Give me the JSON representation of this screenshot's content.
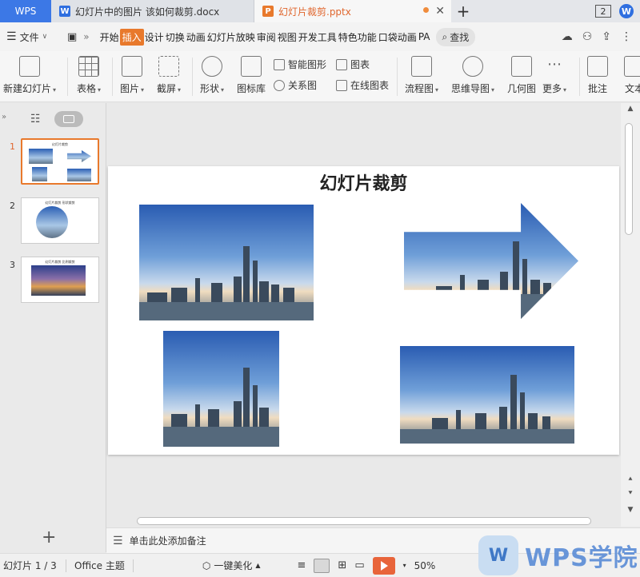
{
  "titlebar": {
    "app_tab": "WPS",
    "tabs": [
      {
        "label": "幻灯片中的图片 该如何裁剪.docx",
        "icon": "W"
      },
      {
        "label": "幻灯片裁剪.pptx",
        "icon": "P"
      }
    ],
    "badge_num": "2"
  },
  "menubar": {
    "file": "文件",
    "items": [
      "开始",
      "插入",
      "设计",
      "切换",
      "动画",
      "幻灯片放映",
      "审阅",
      "视图",
      "开发工具",
      "特色功能",
      "口袋动画",
      "PA"
    ],
    "active": "插入",
    "search": "查找"
  },
  "ribbon": {
    "new_slide": "新建幻灯片",
    "table": "表格",
    "picture": "图片",
    "screenshot": "截屏",
    "shape": "形状",
    "icon_lib": "图标库",
    "smart_art": "智能图形",
    "chart": "图表",
    "relation": "关系图",
    "online_chart": "在线图表",
    "flowchart": "流程图",
    "mindmap": "思维导图",
    "geometry": "几何图",
    "more": "更多",
    "comment": "批注",
    "text": "文本"
  },
  "thumbnails": [
    {
      "num": "1",
      "title": "幻灯片裁剪"
    },
    {
      "num": "2",
      "title": "幻灯片裁剪 形状裁剪"
    },
    {
      "num": "3",
      "title": "幻灯片裁剪 比例裁剪"
    }
  ],
  "slide": {
    "title": "幻灯片裁剪"
  },
  "notes": {
    "placeholder": "单击此处添加备注"
  },
  "statusbar": {
    "slide_info": "幻灯片 1 / 3",
    "theme": "Office 主题",
    "beautify": "一键美化",
    "zoom": "50%"
  },
  "watermark": {
    "text": "WPS学院"
  },
  "colors": {
    "accent": "#e8792c",
    "wps_blue": "#3c78e6"
  }
}
